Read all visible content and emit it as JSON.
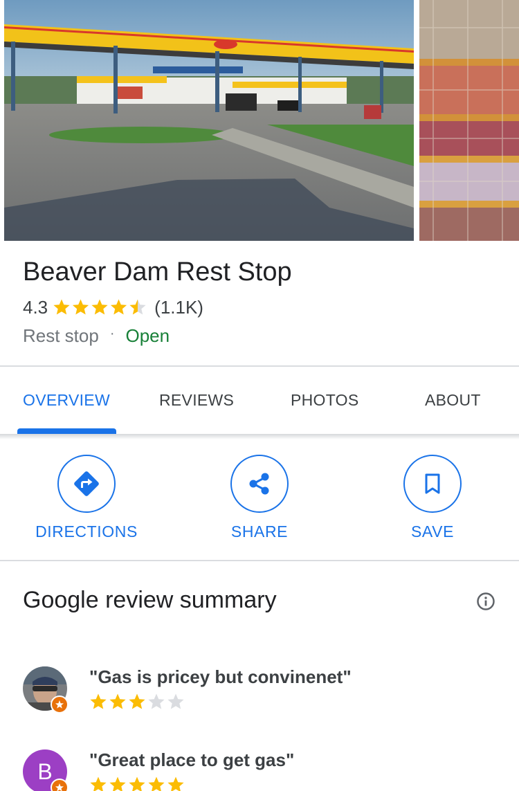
{
  "place": {
    "name": "Beaver Dam Rest Stop",
    "rating": "4.3",
    "rating_value": 4.3,
    "review_count": "(1.1K)",
    "category": "Rest stop",
    "separator": "·",
    "status": "Open"
  },
  "tabs": [
    {
      "label": "OVERVIEW",
      "active": true
    },
    {
      "label": "REVIEWS",
      "active": false
    },
    {
      "label": "PHOTOS",
      "active": false
    },
    {
      "label": "ABOUT",
      "active": false
    }
  ],
  "actions": [
    {
      "label": "DIRECTIONS",
      "icon": "directions-icon"
    },
    {
      "label": "SHARE",
      "icon": "share-icon"
    },
    {
      "label": "SAVE",
      "icon": "bookmark-icon"
    }
  ],
  "review_summary": {
    "title": "Google review summary",
    "reviews": [
      {
        "quote": "\"Gas is pricey but convinenet\"",
        "stars": 3,
        "avatar": "photo",
        "avatar_letter": ""
      },
      {
        "quote": "\"Great place to get gas\"",
        "stars": 5,
        "avatar": "letter",
        "avatar_letter": "B"
      }
    ]
  },
  "colors": {
    "accent": "#1a73e8",
    "star": "#fbbc04",
    "star_empty": "#dadce0",
    "open": "#188038",
    "badge": "#e8710a"
  }
}
